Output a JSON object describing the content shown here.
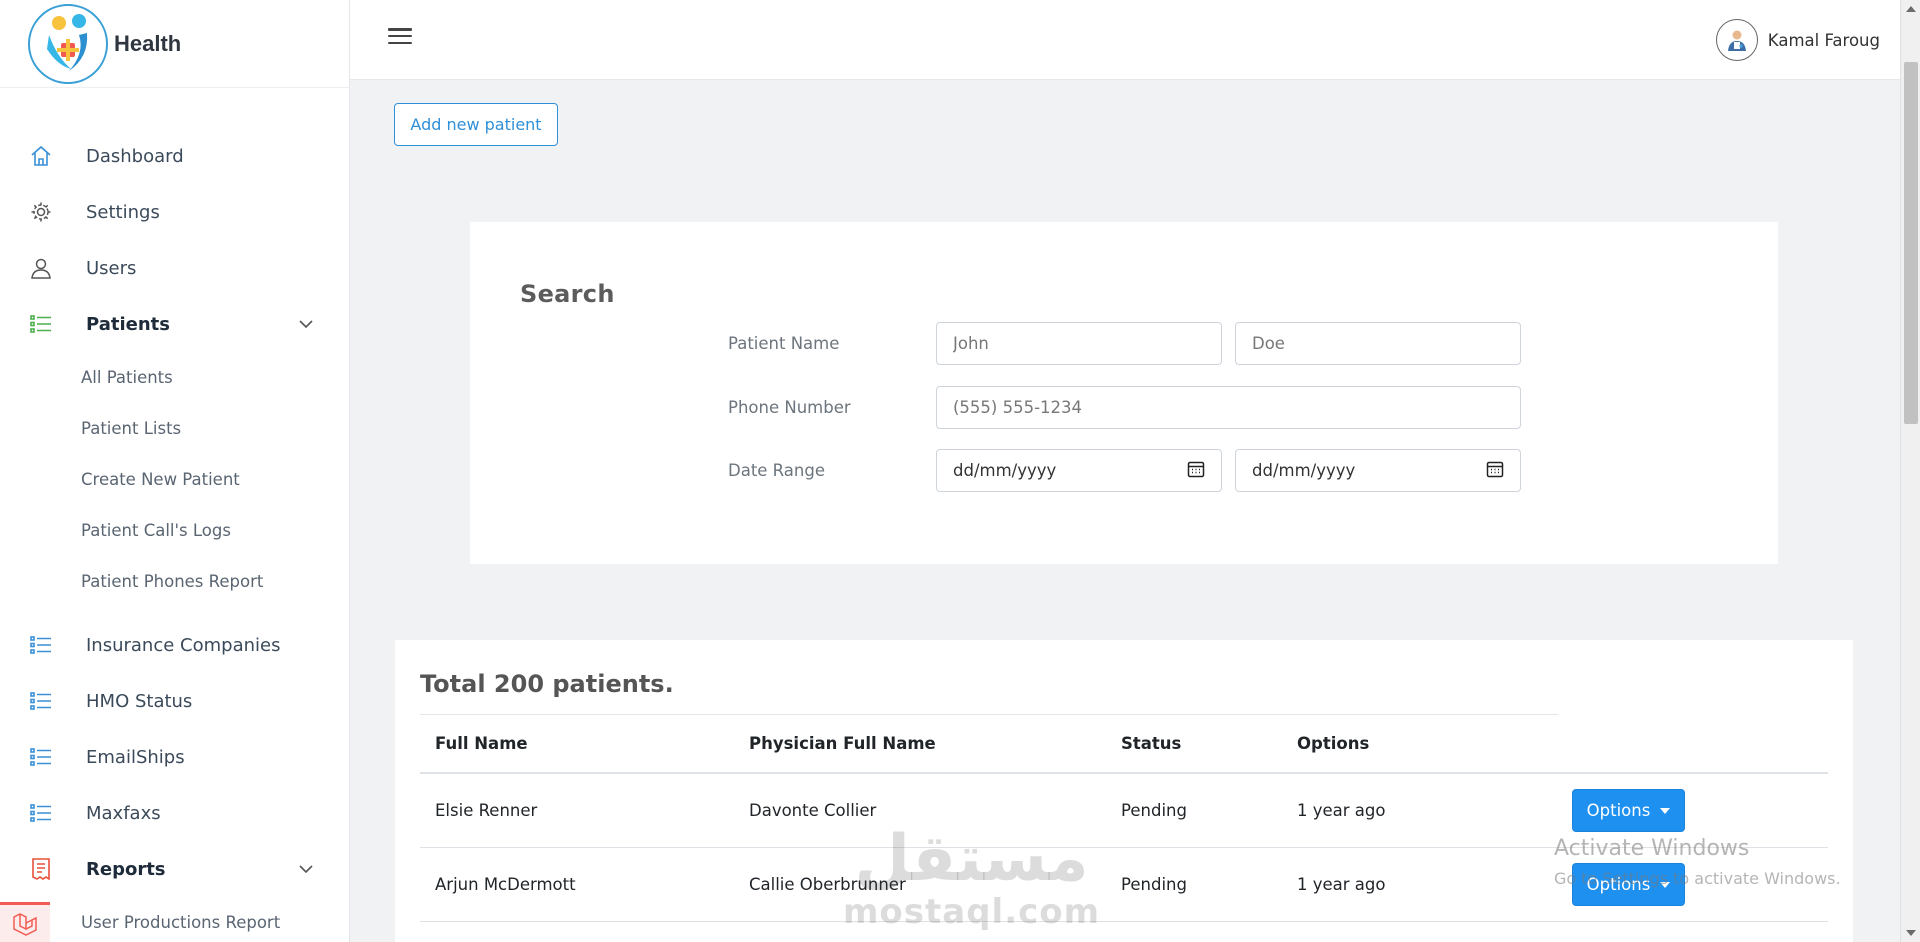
{
  "brand": {
    "name": "Health"
  },
  "sidebar": {
    "items": [
      {
        "label": "Dashboard",
        "icon": "home-icon"
      },
      {
        "label": "Settings",
        "icon": "gear-icon"
      },
      {
        "label": "Users",
        "icon": "user-icon"
      },
      {
        "label": "Patients",
        "icon": "list-icon",
        "active": true,
        "expanded": true
      }
    ],
    "patients_sub": [
      "All Patients",
      "Patient Lists",
      "Create New Patient",
      "Patient Call's Logs",
      "Patient Phones Report"
    ],
    "more_items": [
      {
        "label": "Insurance Companies",
        "icon": "list-icon"
      },
      {
        "label": "HMO Status",
        "icon": "list-icon"
      },
      {
        "label": "EmailShips",
        "icon": "list-icon"
      },
      {
        "label": "Maxfaxs",
        "icon": "list-icon"
      },
      {
        "label": "Reports",
        "icon": "report-icon",
        "expanded": true
      }
    ],
    "reports_sub": [
      "User Productions Report"
    ]
  },
  "header": {
    "user_name": "Kamal Faroug"
  },
  "actions": {
    "add_patient": "Add new patient"
  },
  "search": {
    "title": "Search",
    "patient_name_label": "Patient Name",
    "first_name_placeholder": "John",
    "last_name_placeholder": "Doe",
    "phone_label": "Phone Number",
    "phone_placeholder": "(555) 555-1234",
    "date_range_label": "Date Range",
    "date_from": "dd/mm/yyyy",
    "date_to": "dd/mm/yyyy"
  },
  "table": {
    "total_text": "Total 200 patients.",
    "headers": [
      "Full Name",
      "Physician Full Name",
      "Status",
      "Options"
    ],
    "rows": [
      {
        "name": "Elsie Renner",
        "physician": "Davonte Collier",
        "status": "Pending",
        "time": "1 year ago",
        "button": "Options"
      },
      {
        "name": "Arjun McDermott",
        "physician": "Callie Oberbrunner",
        "status": "Pending",
        "time": "1 year ago",
        "button": "Options"
      }
    ]
  },
  "overlay": {
    "activate_title": "Activate Windows",
    "activate_sub": "Go to Settings to activate Windows.",
    "watermark_ar": "مستقل",
    "watermark_en": "mostaql.com"
  },
  "colors": {
    "accent": "#1e90f0",
    "outline_button": "#2f8fd8",
    "nav_icon_blue": "#3a8fd6",
    "nav_icon_green": "#4caf50",
    "reports_icon": "#e8503a"
  }
}
